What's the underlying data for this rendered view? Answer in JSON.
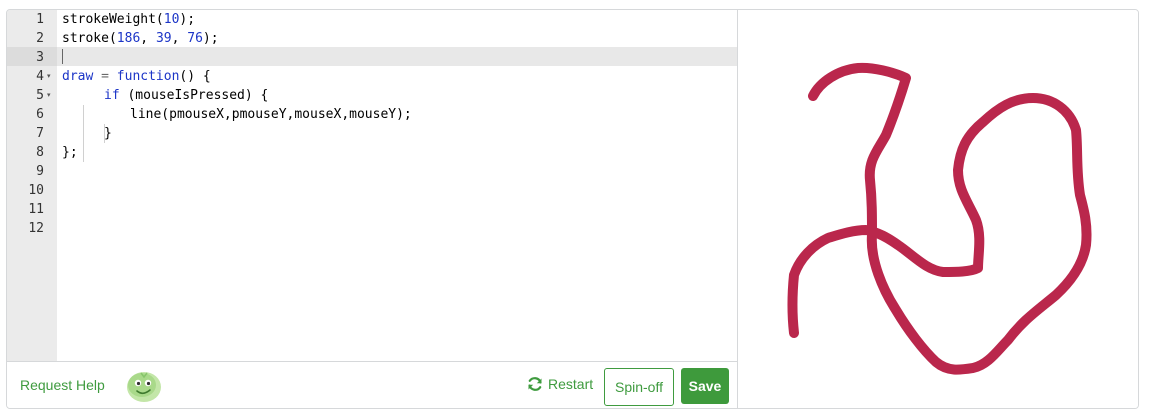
{
  "editor": {
    "line_numbers": [
      "1",
      "2",
      "3",
      "4",
      "5",
      "6",
      "7",
      "8",
      "9",
      "10",
      "11",
      "12"
    ],
    "lines": {
      "l1": {
        "fn": "strokeWeight(",
        "n1": "10",
        "end": ");"
      },
      "l2": {
        "fn": "stroke(",
        "n1": "186",
        "c1": ", ",
        "n2": "39",
        "c2": ", ",
        "n3": "76",
        "end": ");"
      },
      "l4": {
        "var": "draw",
        "op": " = ",
        "kw": "function",
        "end": "() {"
      },
      "l5": {
        "kw": "if",
        "end": " (mouseIsPressed) {"
      },
      "l6": {
        "text": "line(pmouseX,pmouseY,mouseX,mouseY);"
      },
      "l7": {
        "text": "}"
      },
      "l8": {
        "text": "};"
      }
    },
    "fold_marker": "▾"
  },
  "toolbar": {
    "request_help": "Request Help",
    "restart": "Restart",
    "spin_off": "Spin-off",
    "save": "Save"
  },
  "canvas": {
    "stroke_color": "#ba274c",
    "stroke_weight": 10
  }
}
